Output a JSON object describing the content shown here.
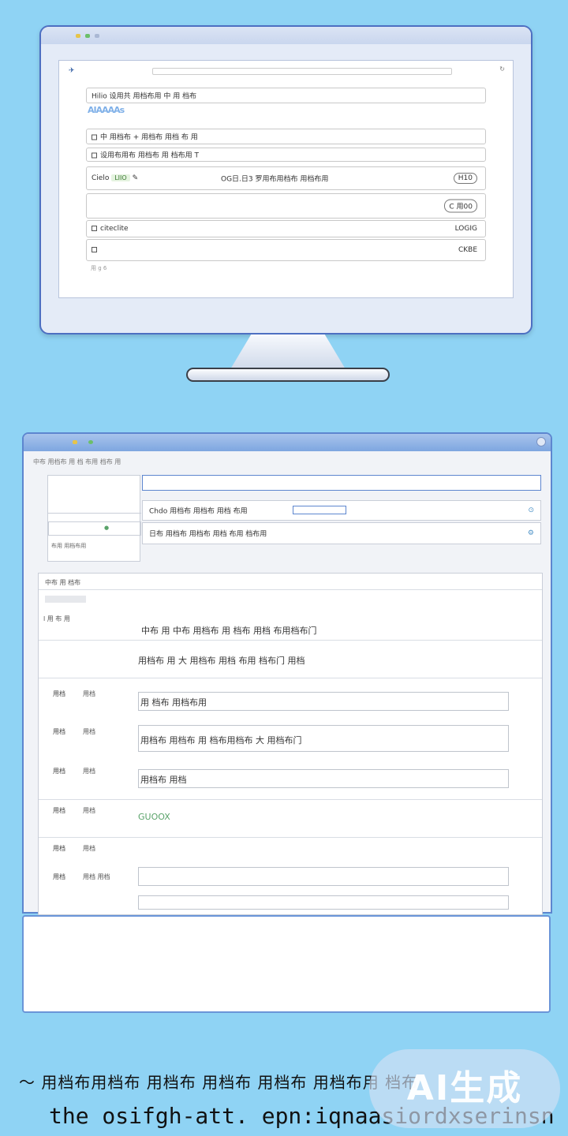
{
  "monitor": {
    "screen": {
      "row1": "Hilio 设用共 用档布用 中 用 档布",
      "colorful_text": "AIAAAAs",
      "row2": "中 用档布 + 用档布 用档 布 用",
      "row3": "设用布用布 用档布 用 档布用 T",
      "row4_left": "Cielo",
      "row4_badge": "LIIO",
      "row4_center": "OG日.日3 罗用布用档布 用档布用",
      "row4_right": "H10",
      "row5_right": "C 用00",
      "row6_left": "citeclite",
      "row6_right": "LOGIG",
      "row7_right": "CKBE",
      "footnote": "用 g 6"
    }
  },
  "window": {
    "menu": "中布 用档布 用 档 布用 档布 用",
    "search_label": "Chdo 用档布 用档布 用档 布用",
    "field2_label": "日布 用档布 用档布 用档 布用 档布用",
    "left_panel_tag": "布用 用档布用",
    "form": {
      "head": "中布 用 档布",
      "group": "l 用 布 用",
      "line1": "中布 用 中布 用档布 用 档布 用档 布用档布门",
      "line2": "用档布 用 大 用档布 用档 布用 档布门 用档",
      "rows": [
        {
          "label": "用档",
          "mini": "用档",
          "value": "用 档布 用档布用"
        },
        {
          "label": "用档",
          "mini": "用档",
          "value": "用档布 用档布 用 档布用档布 大 用档布门"
        },
        {
          "label": "用档",
          "mini": "用档",
          "value": "用档布 用档"
        },
        {
          "label": "用档",
          "mini": "用档",
          "value": "GUOOX"
        },
        {
          "label": "用档",
          "mini": "用档",
          "value": ""
        },
        {
          "label": "用档",
          "mini": "用档 用档",
          "value": ""
        }
      ]
    }
  },
  "caption": {
    "line1": "〜 用档布用档布 用档布 用档布 用档布 用档布用 档布",
    "line2": "the osifgh-att. epn:iqnaasiordxserinsn"
  },
  "watermark": "AI生成"
}
